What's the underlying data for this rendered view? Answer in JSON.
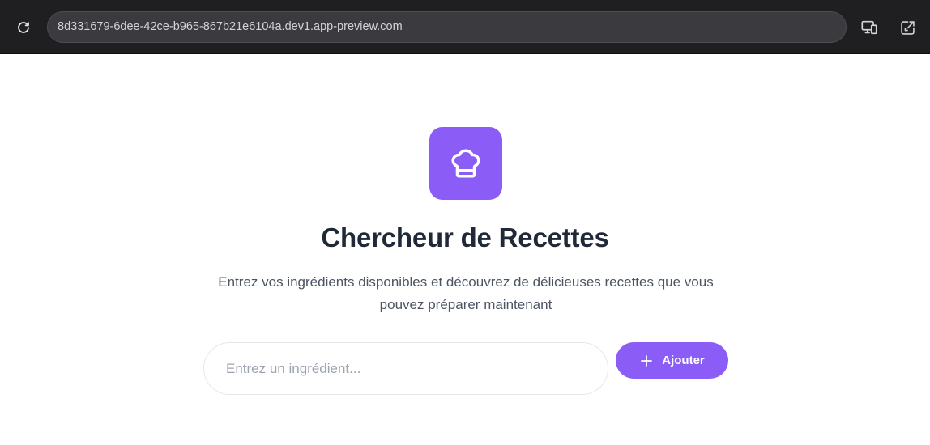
{
  "browser": {
    "url": "8d331679-6dee-42ce-b965-867b21e6104a.dev1.app-preview.com"
  },
  "hero": {
    "icon": "chef-hat-icon",
    "title": "Chercheur de Recettes",
    "subtitle": "Entrez vos ingrédients disponibles et découvrez de délicieuses recettes que vous pouvez préparer maintenant"
  },
  "ingredient_form": {
    "placeholder": "Entrez un ingrédient...",
    "value": "",
    "add_label": "Ajouter"
  },
  "colors": {
    "accent": "#8b5cf6",
    "title": "#1f2937",
    "subtitle": "#4b5563",
    "browser_bar": "#1f1f21"
  }
}
